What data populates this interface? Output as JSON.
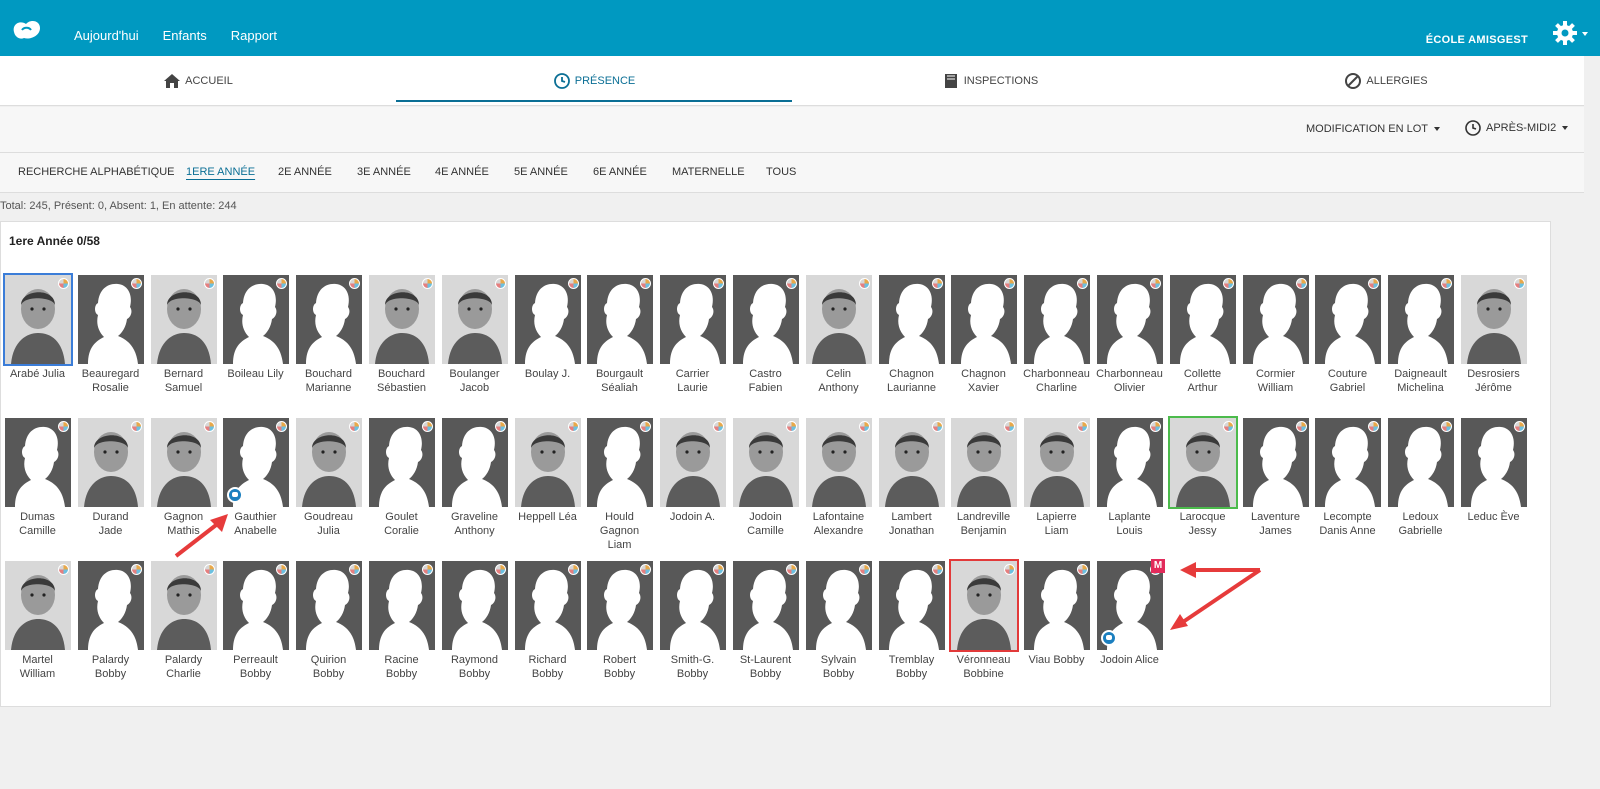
{
  "app": {
    "nav": [
      "Aujourd'hui",
      "Enfants",
      "Rapport"
    ],
    "school": "ÉCOLE AMISGEST"
  },
  "main_tabs": [
    {
      "label": "ACCUEIL",
      "icon": "home-icon"
    },
    {
      "label": "PRÉSENCE",
      "icon": "clock-icon",
      "active": true
    },
    {
      "label": "INSPECTIONS",
      "icon": "book-icon"
    },
    {
      "label": "ALLERGIES",
      "icon": "ban-icon"
    }
  ],
  "toolbar": {
    "batch": "MODIFICATION EN LOT",
    "period": "APRÈS-MIDI2"
  },
  "grade_tabs": [
    "RECHERCHE ALPHABÉTIQUE",
    "1ERE ANNÉE",
    "2E ANNÉE",
    "3E ANNÉE",
    "4E ANNÉE",
    "5E ANNÉE",
    "6E ANNÉE",
    "MATERNELLE",
    "TOUS"
  ],
  "active_grade": "1ERE ANNÉE",
  "stats": "Total: 245, Présent: 0, Absent: 1, En attente: 244",
  "panel_title": "1ere Année 0/58",
  "students": [
    [
      "Arabé Julia"
    ],
    [
      "Beauregard",
      "Rosalie"
    ],
    [
      "Bernard",
      "Samuel"
    ],
    [
      "Boileau Lily"
    ],
    [
      "Bouchard",
      "Marianne"
    ],
    [
      "Bouchard",
      "Sébastien"
    ],
    [
      "Boulanger",
      "Jacob"
    ],
    [
      "Boulay J."
    ],
    [
      "Bourgault",
      "Séaliah"
    ],
    [
      "Carrier",
      "Laurie"
    ],
    [
      "Castro",
      "Fabien"
    ],
    [
      "Celin",
      "Anthony"
    ],
    [
      "Chagnon",
      "Laurianne"
    ],
    [
      "Chagnon",
      "Xavier"
    ],
    [
      "Charbonneau",
      "Charline"
    ],
    [
      "Charbonneau",
      "Olivier"
    ],
    [
      "Collette",
      "Arthur"
    ],
    [
      "Cormier",
      "William"
    ],
    [
      "Couture",
      "Gabriel"
    ],
    [
      "Daigneault",
      "Michelina"
    ],
    [
      "Desrosiers",
      "Jérôme"
    ],
    [
      "Dumas",
      "Camille"
    ],
    [
      "Durand",
      "Jade"
    ],
    [
      "Gagnon",
      "Mathis"
    ],
    [
      "Gauthier",
      "Anabelle"
    ],
    [
      "Goudreau",
      "Julia"
    ],
    [
      "Goulet",
      "Coralie"
    ],
    [
      "Graveline",
      "Anthony"
    ],
    [
      "Heppell Léa"
    ],
    [
      "Hould",
      "Gagnon",
      "Liam"
    ],
    [
      "Jodoin A."
    ],
    [
      "Jodoin",
      "Camille"
    ],
    [
      "Lafontaine",
      "Alexandre"
    ],
    [
      "Lambert",
      "Jonathan"
    ],
    [
      "Landreville",
      "Benjamin"
    ],
    [
      "Lapierre",
      "Liam"
    ],
    [
      "Laplante",
      "Louis"
    ],
    [
      "Larocque",
      "Jessy"
    ],
    [
      "Laventure",
      "James"
    ],
    [
      "Lecompte",
      "Danis Anne"
    ],
    [
      "Ledoux",
      "Gabrielle"
    ],
    [
      "Leduc Ève"
    ],
    [
      "Martel",
      "William"
    ],
    [
      "Palardy",
      "Bobby"
    ],
    [
      "Palardy",
      "Charlie"
    ],
    [
      "Perreault",
      "Bobby"
    ],
    [
      "Quirion",
      "Bobby"
    ],
    [
      "Racine",
      "Bobby"
    ],
    [
      "Raymond",
      "Bobby"
    ],
    [
      "Richard",
      "Bobby"
    ],
    [
      "Robert",
      "Bobby"
    ],
    [
      "Smith-G.",
      "Bobby"
    ],
    [
      "St-Laurent",
      "Bobby"
    ],
    [
      "Sylvain",
      "Bobby"
    ],
    [
      "Tremblay",
      "Bobby"
    ],
    [
      "Véronneau",
      "Bobbine"
    ],
    [
      "Viau Bobby"
    ],
    [
      "Jodoin Alice"
    ]
  ],
  "real_photos": [
    0,
    2,
    5,
    6,
    11,
    20,
    22,
    23,
    25,
    28,
    30,
    31,
    32,
    33,
    34,
    35,
    37,
    42,
    44,
    55
  ],
  "selected": {
    "blue": 0,
    "green": 37,
    "red": 55
  },
  "message_badges": [
    24,
    57
  ],
  "m_badge_index": 57,
  "m_badge_label": "M",
  "colors": {
    "topbar": "#0099c1",
    "active": "#0b6f95",
    "arrow": "#e63b3b"
  }
}
